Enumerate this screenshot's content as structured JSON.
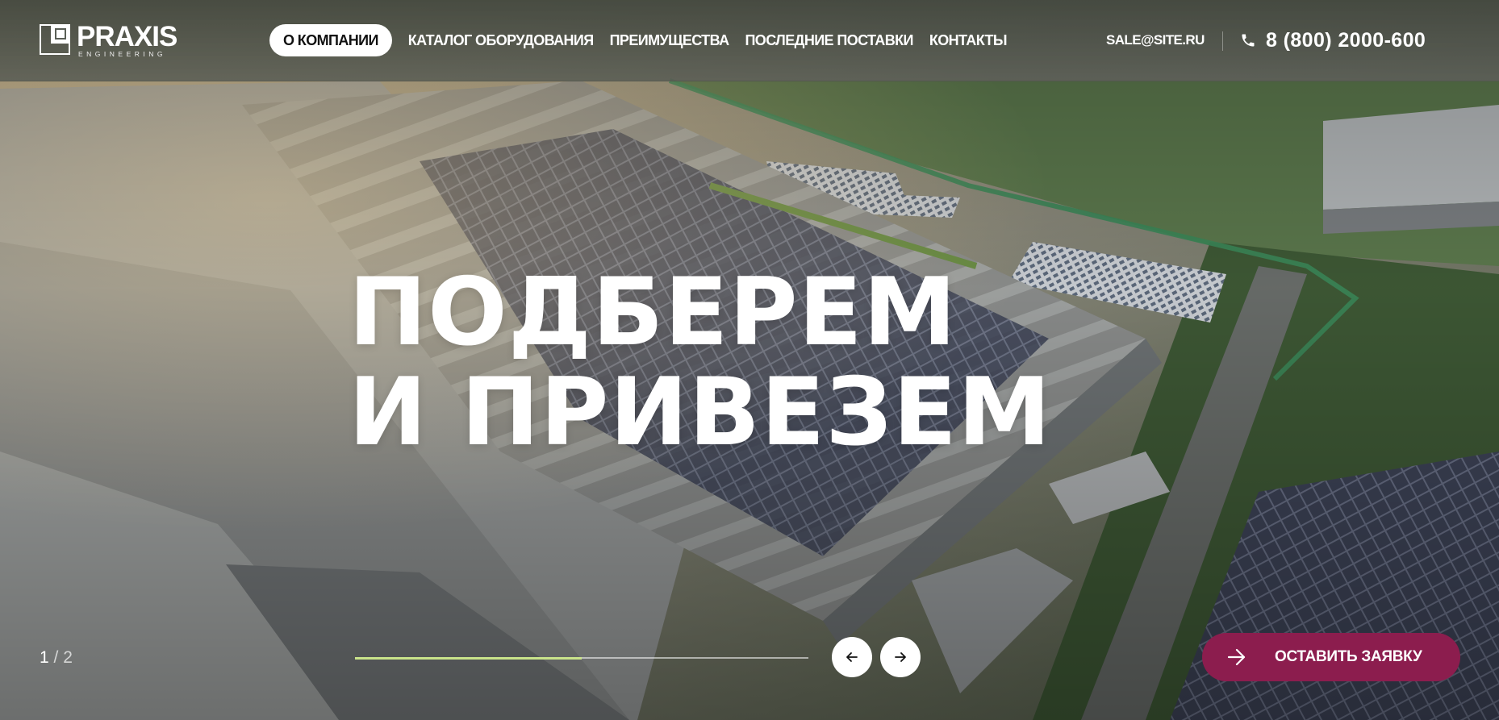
{
  "brand": {
    "name": "PRAXIS",
    "tagline": "ENGINEERING"
  },
  "nav": {
    "items": [
      {
        "label": "О КОМПАНИИ",
        "active": true
      },
      {
        "label": "КАТАЛОГ ОБОРУДОВАНИЯ",
        "active": false
      },
      {
        "label": "ПРЕИМУЩЕСТВА",
        "active": false
      },
      {
        "label": "ПОСЛЕДНИЕ ПОСТАВКИ",
        "active": false
      },
      {
        "label": "КОНТАКТЫ",
        "active": false
      }
    ]
  },
  "contacts": {
    "email": "SALE@SITE.RU",
    "phone": "8 (800) 2000-600",
    "phone_icon": "phone-icon"
  },
  "hero": {
    "line1": "ПОДБЕРЕМ",
    "line2": "И ПРИВЕЗЕМ",
    "background": "aerial view of industrial warehouse complex with solar panels"
  },
  "slider": {
    "current": "1",
    "separator": "/",
    "total": "2",
    "progress": 0.5,
    "progress_color": "#c9e38a",
    "prev_icon": "arrow-left-icon",
    "next_icon": "arrow-right-icon"
  },
  "cta": {
    "label": "ОСТАВИТЬ ЗАЯВКУ",
    "icon": "arrow-right-icon",
    "color": "#8c1d4e"
  }
}
